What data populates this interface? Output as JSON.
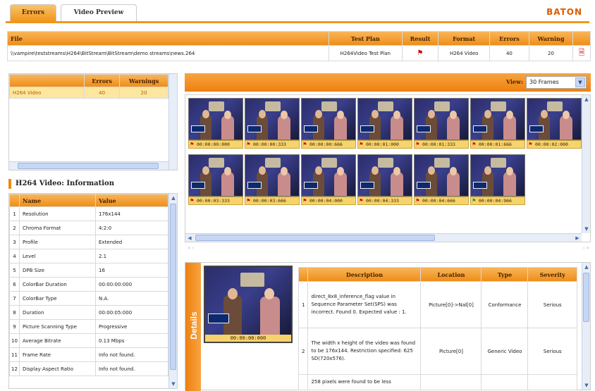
{
  "tabs": [
    {
      "label": "Errors"
    },
    {
      "label": "Video Preview"
    }
  ],
  "brand": "BATON",
  "file_table": {
    "headers": [
      "File",
      "Test Plan",
      "Result",
      "Format",
      "Errors",
      "Warning"
    ],
    "row": {
      "file": "\\\\vampire\\teststreams\\H264\\BitStream\\BitStream\\demo streams\\news.264",
      "test_plan": "H264Video Test Plan",
      "format": "H264 Video",
      "errors": "40",
      "warning": "20"
    }
  },
  "summary": {
    "headers": [
      "",
      "Errors",
      "Warnings"
    ],
    "rows": [
      {
        "name": "H264 Video",
        "errors": "40",
        "warnings": "20"
      }
    ]
  },
  "info": {
    "title": "H264 Video: Information",
    "headers": [
      "",
      "Name",
      "Value"
    ],
    "rows": [
      {
        "n": "1",
        "name": "Resolution",
        "value": "176x144"
      },
      {
        "n": "2",
        "name": "Chroma Format",
        "value": "4:2:0"
      },
      {
        "n": "3",
        "name": "Profile",
        "value": "Extended"
      },
      {
        "n": "4",
        "name": "Level",
        "value": "2.1"
      },
      {
        "n": "5",
        "name": "DPB Size",
        "value": "16"
      },
      {
        "n": "6",
        "name": "ColorBar Duration",
        "value": "00:00:00:000"
      },
      {
        "n": "7",
        "name": "ColorBar Type",
        "value": "N.A."
      },
      {
        "n": "8",
        "name": "Duration",
        "value": "00:00:05:000"
      },
      {
        "n": "9",
        "name": "Picture Scanning Type",
        "value": "Progressive"
      },
      {
        "n": "10",
        "name": "Average Bitrate",
        "value": "0.13 Mbps"
      },
      {
        "n": "11",
        "name": "Frame Rate",
        "value": "Info not found."
      },
      {
        "n": "12",
        "name": "Display Aspect Ratio",
        "value": "Info not found."
      }
    ]
  },
  "view": {
    "label": "View:",
    "selected": "30 Frames"
  },
  "frames": [
    {
      "tc": "00:00:00:000"
    },
    {
      "tc": "00:00:00:333"
    },
    {
      "tc": "00:00:00:666"
    },
    {
      "tc": "00:00:01:000"
    },
    {
      "tc": "00:00:01:333"
    },
    {
      "tc": "00:00:01:666"
    },
    {
      "tc": "00:00:02:000"
    },
    {
      "tc": "00:00:03:333"
    },
    {
      "tc": "00:00:03:666"
    },
    {
      "tc": "00:00:04:000"
    },
    {
      "tc": "00:00:04:333"
    },
    {
      "tc": "00:00:04:666"
    },
    {
      "tc": "00:00:04:966"
    }
  ],
  "details": {
    "label": "Details",
    "timecode": "00:00:00:000",
    "headers": [
      "",
      "Description",
      "Location",
      "Type",
      "Severity"
    ],
    "rows": [
      {
        "n": "1",
        "description": "direct_8x8_inference_flag value in Sequence Parameter Set(SPS) was incorrect. Found 0. Expected value : 1.",
        "location": "Picture[0]->Nal[0]",
        "type": "Conformance",
        "severity": "Serious"
      },
      {
        "n": "2",
        "description": "The width x height of the video was found to be 176x144. Restriction specified: 625 SD(720x576).",
        "location": "Picture[0]",
        "type": "Generic Video",
        "severity": "Serious"
      },
      {
        "n": "",
        "description": "258 pixels were found to be less",
        "location": "",
        "type": "",
        "severity": ""
      }
    ]
  }
}
